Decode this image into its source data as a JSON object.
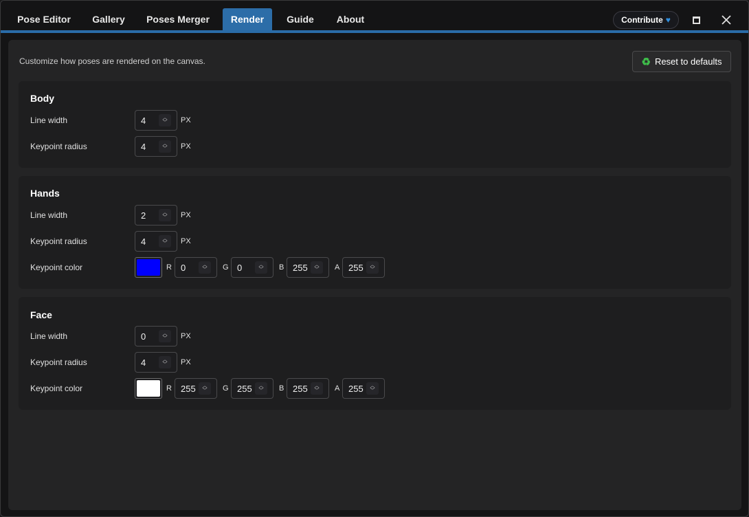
{
  "tabs": [
    {
      "label": "Pose Editor",
      "active": false
    },
    {
      "label": "Gallery",
      "active": false
    },
    {
      "label": "Poses Merger",
      "active": false
    },
    {
      "label": "Render",
      "active": true
    },
    {
      "label": "Guide",
      "active": false
    },
    {
      "label": "About",
      "active": false
    }
  ],
  "header": {
    "contribute_label": "Contribute",
    "heart_icon": "heart-icon",
    "maximize_icon": "maximize-icon",
    "close_icon": "close-icon"
  },
  "main": {
    "description": "Customize how poses are rendered on the canvas.",
    "reset_label": "Reset to defaults",
    "reset_icon": "recycle-icon"
  },
  "sections": {
    "body": {
      "title": "Body",
      "line_width_label": "Line width",
      "line_width": "4",
      "line_width_unit": "PX",
      "keypoint_radius_label": "Keypoint radius",
      "keypoint_radius": "4",
      "keypoint_radius_unit": "PX"
    },
    "hands": {
      "title": "Hands",
      "line_width_label": "Line width",
      "line_width": "2",
      "line_width_unit": "PX",
      "keypoint_radius_label": "Keypoint radius",
      "keypoint_radius": "4",
      "keypoint_radius_unit": "PX",
      "keypoint_color_label": "Keypoint color",
      "color_hex": "#0000ff",
      "r_label": "R",
      "r": "0",
      "g_label": "G",
      "g": "0",
      "b_label": "B",
      "b": "255",
      "a_label": "A",
      "a": "255"
    },
    "face": {
      "title": "Face",
      "line_width_label": "Line width",
      "line_width": "0",
      "line_width_unit": "PX",
      "keypoint_radius_label": "Keypoint radius",
      "keypoint_radius": "4",
      "keypoint_radius_unit": "PX",
      "keypoint_color_label": "Keypoint color",
      "color_hex": "#ffffff",
      "r_label": "R",
      "r": "255",
      "g_label": "G",
      "g": "255",
      "b_label": "B",
      "b": "255",
      "a_label": "A",
      "a": "255"
    }
  },
  "colors": {
    "accent": "#2c6da8"
  }
}
